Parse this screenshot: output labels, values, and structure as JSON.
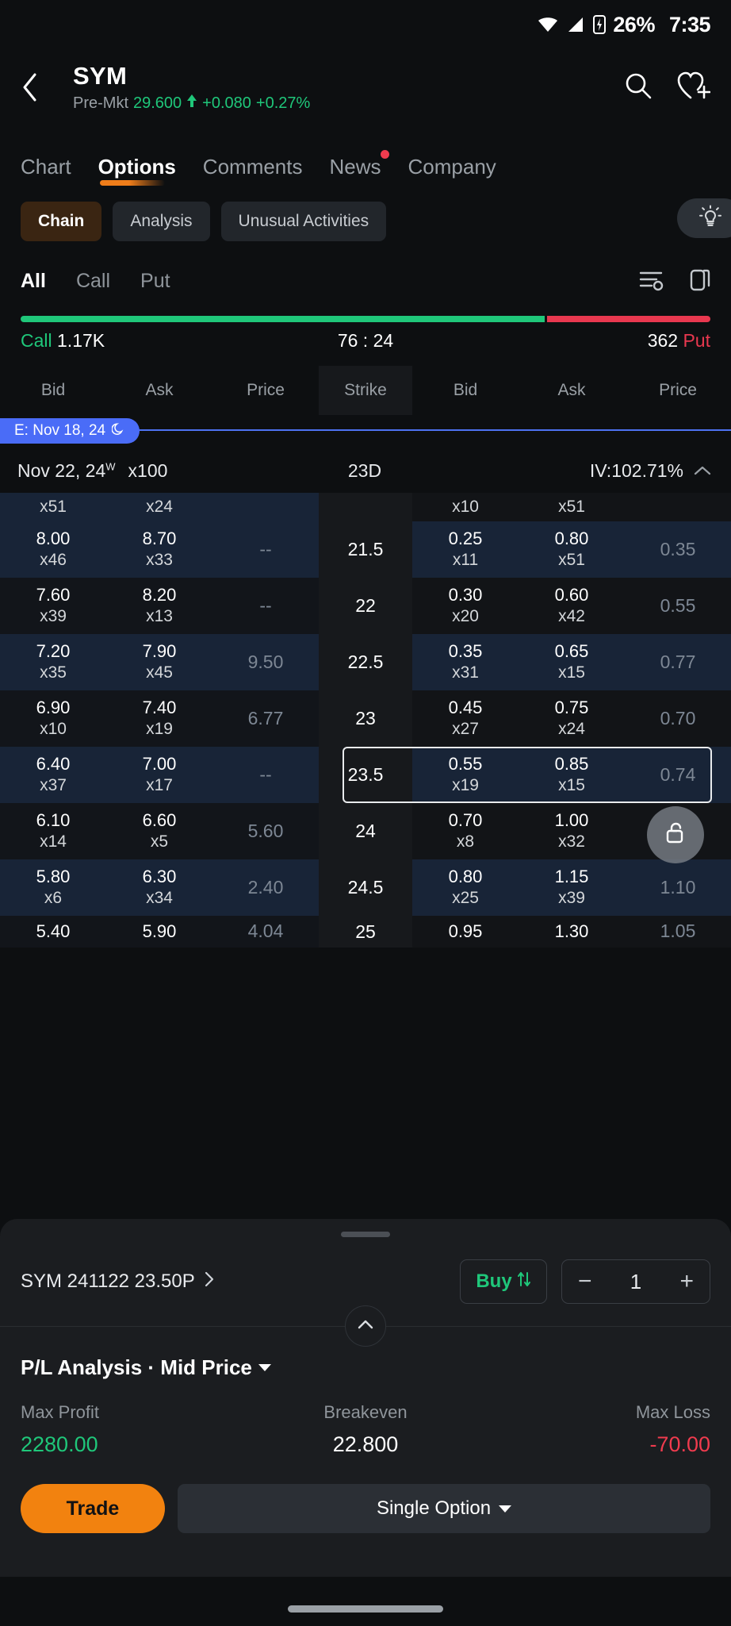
{
  "status_bar": {
    "battery_pct": "26%",
    "time": "7:35",
    "wifi_icon": "wifi-icon",
    "signal_icon": "cellular-signal-icon",
    "battery_icon": "battery-charging-icon"
  },
  "header": {
    "back_icon": "chevron-left-icon",
    "ticker": "SYM",
    "session_label": "Pre-Mkt",
    "price": "29.600",
    "arrow": "▲",
    "change": "+0.080",
    "change_pct": "+0.27%",
    "search_icon": "search-icon",
    "watchlist_icon": "heart-plus-icon"
  },
  "main_tabs": [
    {
      "label": "Chart",
      "active": false,
      "badge": false
    },
    {
      "label": "Options",
      "active": true,
      "badge": false
    },
    {
      "label": "Comments",
      "active": false,
      "badge": false
    },
    {
      "label": "News",
      "active": false,
      "badge": true
    },
    {
      "label": "Company",
      "active": false,
      "badge": false
    }
  ],
  "sub_chips": [
    {
      "label": "Chain",
      "active": true
    },
    {
      "label": "Analysis",
      "active": false
    },
    {
      "label": "Unusual Activities",
      "active": false
    }
  ],
  "bulb_icon": "lightbulb-icon",
  "type_filters": [
    {
      "label": "All",
      "active": true
    },
    {
      "label": "Call",
      "active": false
    },
    {
      "label": "Put",
      "active": false
    }
  ],
  "toolbar_icons": {
    "settings_icon": "column-settings-icon",
    "layout_icon": "layout-toggle-icon"
  },
  "ratio": {
    "call_label": "Call",
    "call_volume": "1.17K",
    "ratio_text": "76 : 24",
    "put_volume": "362",
    "put_label": "Put",
    "call_pct": 76,
    "put_pct": 24,
    "call_color": "#1fc77a",
    "put_color": "#e8384f"
  },
  "columns": {
    "call": [
      "Bid",
      "Ask",
      "Price"
    ],
    "strike": "Strike",
    "put": [
      "Bid",
      "Ask",
      "Price"
    ]
  },
  "expiration": {
    "pill_label": "E: Nov 18, 24",
    "pill_icon": "moon-icon",
    "date": "Nov 22, 24",
    "weekly_sup": "W",
    "multiplier": "x100",
    "days": "23D",
    "iv": "IV:102.71%",
    "collapse_icon": "chevron-up-icon"
  },
  "chain_rows": [
    {
      "partial": true,
      "strike": "",
      "call": {
        "bid": "",
        "bid_sz": "x51",
        "ask": "",
        "ask_sz": "x24",
        "price": ""
      },
      "put": {
        "bid": "",
        "bid_sz": "x10",
        "ask": "",
        "ask_sz": "x51",
        "price": ""
      },
      "call_itm": true,
      "put_itm": false,
      "selected": false
    },
    {
      "strike": "21.5",
      "call": {
        "bid": "8.00",
        "bid_sz": "x46",
        "ask": "8.70",
        "ask_sz": "x33",
        "price": "--"
      },
      "put": {
        "bid": "0.25",
        "bid_sz": "x11",
        "ask": "0.80",
        "ask_sz": "x51",
        "price": "0.35"
      },
      "call_itm": true,
      "put_itm": true,
      "selected": false
    },
    {
      "strike": "22",
      "call": {
        "bid": "7.60",
        "bid_sz": "x39",
        "ask": "8.20",
        "ask_sz": "x13",
        "price": "--"
      },
      "put": {
        "bid": "0.30",
        "bid_sz": "x20",
        "ask": "0.60",
        "ask_sz": "x42",
        "price": "0.55"
      },
      "call_itm": false,
      "put_itm": false,
      "selected": false
    },
    {
      "strike": "22.5",
      "call": {
        "bid": "7.20",
        "bid_sz": "x35",
        "ask": "7.90",
        "ask_sz": "x45",
        "price": "9.50"
      },
      "put": {
        "bid": "0.35",
        "bid_sz": "x31",
        "ask": "0.65",
        "ask_sz": "x15",
        "price": "0.77"
      },
      "call_itm": true,
      "put_itm": true,
      "selected": false
    },
    {
      "strike": "23",
      "call": {
        "bid": "6.90",
        "bid_sz": "x10",
        "ask": "7.40",
        "ask_sz": "x19",
        "price": "6.77"
      },
      "put": {
        "bid": "0.45",
        "bid_sz": "x27",
        "ask": "0.75",
        "ask_sz": "x24",
        "price": "0.70"
      },
      "call_itm": false,
      "put_itm": false,
      "selected": false
    },
    {
      "strike": "23.5",
      "call": {
        "bid": "6.40",
        "bid_sz": "x37",
        "ask": "7.00",
        "ask_sz": "x17",
        "price": "--"
      },
      "put": {
        "bid": "0.55",
        "bid_sz": "x19",
        "ask": "0.85",
        "ask_sz": "x15",
        "price": "0.74"
      },
      "call_itm": true,
      "put_itm": true,
      "selected": true
    },
    {
      "strike": "24",
      "call": {
        "bid": "6.10",
        "bid_sz": "x14",
        "ask": "6.60",
        "ask_sz": "x5",
        "price": "5.60"
      },
      "put": {
        "bid": "0.70",
        "bid_sz": "x8",
        "ask": "1.00",
        "ask_sz": "x32",
        "price": "--"
      },
      "call_itm": false,
      "put_itm": false,
      "selected": false
    },
    {
      "strike": "24.5",
      "call": {
        "bid": "5.80",
        "bid_sz": "x6",
        "ask": "6.30",
        "ask_sz": "x34",
        "price": "2.40"
      },
      "put": {
        "bid": "0.80",
        "bid_sz": "x25",
        "ask": "1.15",
        "ask_sz": "x39",
        "price": "1.10"
      },
      "call_itm": true,
      "put_itm": true,
      "selected": false
    },
    {
      "strike": "25",
      "call": {
        "bid": "5.40",
        "bid_sz": "",
        "ask": "5.90",
        "ask_sz": "",
        "price": "4.04"
      },
      "put": {
        "bid": "0.95",
        "bid_sz": "",
        "ask": "1.30",
        "ask_sz": "",
        "price": "1.05"
      },
      "call_itm": false,
      "put_itm": false,
      "selected": false
    }
  ],
  "lock_fab_icon": "lock-open-icon",
  "order_panel": {
    "contract": "SYM 241122 23.50P",
    "contract_chevron_icon": "chevron-right-icon",
    "side_label": "Buy",
    "side_swap_icon": "swap-vertical-icon",
    "qty_minus": "−",
    "qty_value": "1",
    "qty_plus": "+",
    "expand_icon": "chevron-up-icon"
  },
  "pl_analysis": {
    "title": "P/L Analysis · Mid Price",
    "dropdown_icon": "caret-down-icon",
    "metrics": [
      {
        "label": "Max Profit",
        "value": "2280.00",
        "tone": "pos"
      },
      {
        "label": "Breakeven",
        "value": "22.800",
        "tone": "neu"
      },
      {
        "label": "Max Loss",
        "value": "-70.00",
        "tone": "neg"
      }
    ]
  },
  "footer": {
    "trade_label": "Trade",
    "strategy_label": "Single Option",
    "strategy_icon": "caret-down-icon"
  },
  "colors": {
    "accent_orange": "#f2820f",
    "up_green": "#1fc77a",
    "down_red": "#ef3b4e",
    "exp_blue": "#4a6cf7",
    "itm_blue_bg": "#182437"
  }
}
